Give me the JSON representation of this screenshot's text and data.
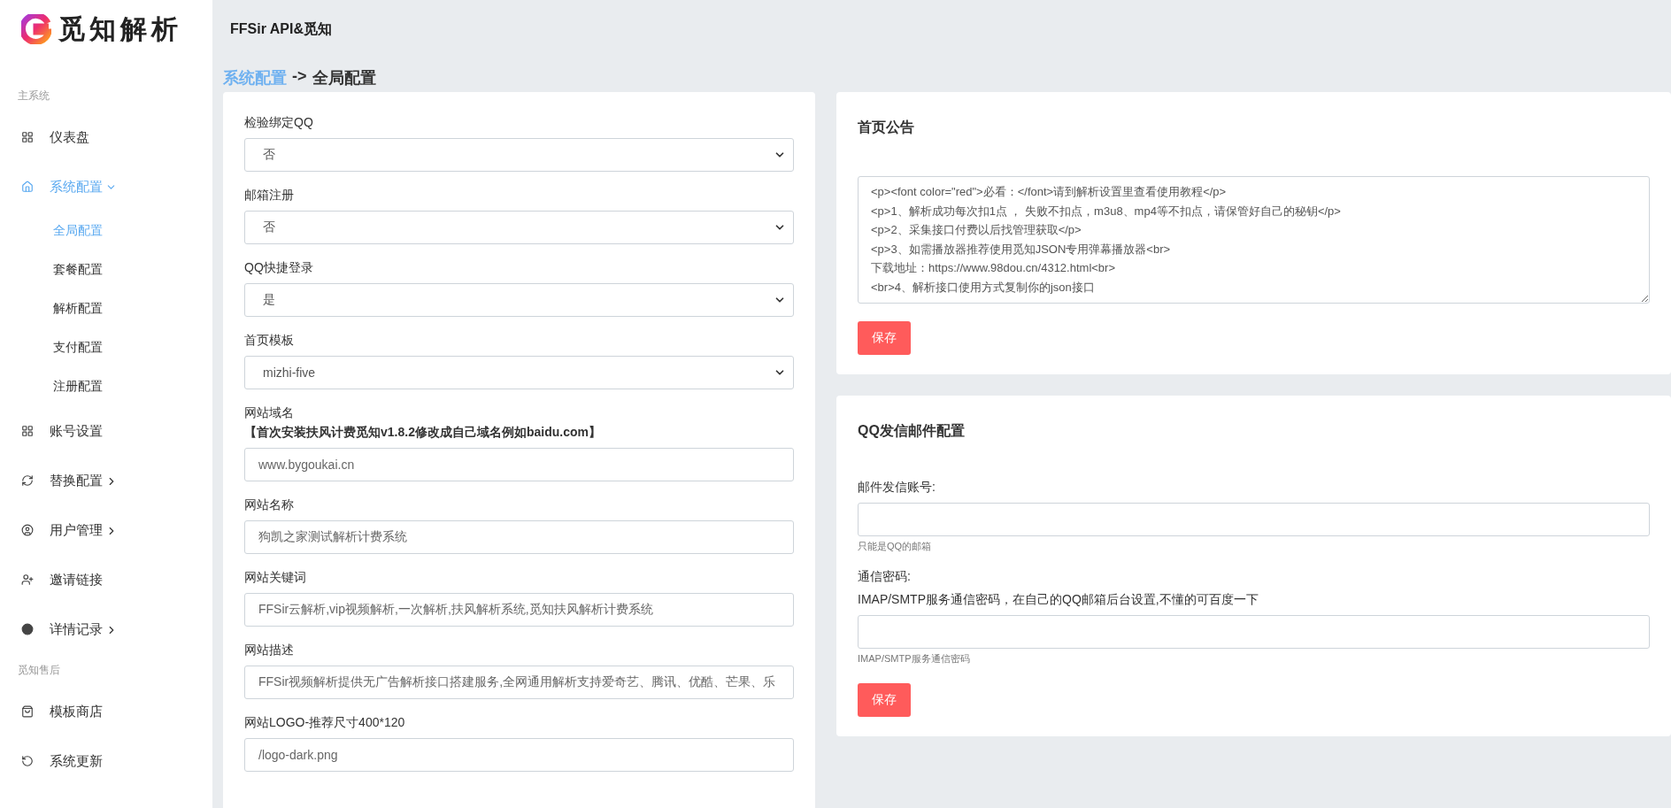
{
  "logo": {
    "text": "觅知解析"
  },
  "header": {
    "title": "FFSir API&觅知"
  },
  "sidebar": {
    "sections": [
      {
        "title": "主系统",
        "items": [
          {
            "label": "仪表盘",
            "has_submenu": false,
            "selected": false
          },
          {
            "label": "系统配置",
            "has_submenu": true,
            "expanded": true,
            "selected": true,
            "children": [
              {
                "label": "全局配置",
                "selected": true
              },
              {
                "label": "套餐配置",
                "selected": false
              },
              {
                "label": "解析配置",
                "selected": false
              },
              {
                "label": "支付配置",
                "selected": false
              },
              {
                "label": "注册配置",
                "selected": false
              }
            ]
          },
          {
            "label": "账号设置",
            "has_submenu": false,
            "selected": false
          },
          {
            "label": "替换配置",
            "has_submenu": true,
            "expanded": false,
            "selected": false
          },
          {
            "label": "用户管理",
            "has_submenu": true,
            "expanded": false,
            "selected": false
          },
          {
            "label": "邀请链接",
            "has_submenu": false,
            "selected": false
          },
          {
            "label": "详情记录",
            "has_submenu": true,
            "expanded": false,
            "selected": false
          }
        ]
      },
      {
        "title": "觅知售后",
        "items": [
          {
            "label": "模板商店",
            "has_submenu": false,
            "selected": false
          },
          {
            "label": "系统更新",
            "has_submenu": false,
            "selected": false
          }
        ]
      }
    ]
  },
  "breadcrumb": {
    "parent": "系统配置",
    "separator": "->",
    "current": "全局配置"
  },
  "global_form": {
    "fields": [
      {
        "kind": "select",
        "label": "检验绑定QQ",
        "value": "否"
      },
      {
        "kind": "select",
        "label": "邮箱注册",
        "value": "否"
      },
      {
        "kind": "select",
        "label": "QQ快捷登录",
        "value": "是"
      },
      {
        "kind": "select",
        "label": "首页模板",
        "value": "mizhi-five"
      },
      {
        "kind": "input",
        "label": "网站域名",
        "note": "【首次安装扶风计费觅知v1.8.2修改成自己域名例如baidu.com】",
        "value": "www.bygoukai.cn"
      },
      {
        "kind": "input",
        "label": "网站名称",
        "value": "狗凯之家测试解析计费系统"
      },
      {
        "kind": "input",
        "label": "网站关键词",
        "value": "FFSir云解析,vip视频解析,一次解析,扶风解析系统,觅知扶风解析计费系统"
      },
      {
        "kind": "input",
        "label": "网站描述",
        "value": "FFSir视频解析提供无广告解析接口搭建服务,全网通用解析支持爱奇艺、腾讯、优酷、芒果、乐"
      },
      {
        "kind": "input",
        "label": "网站LOGO-推荐尺寸400*120",
        "value": "/logo-dark.png"
      }
    ]
  },
  "notice_card": {
    "title": "首页公告",
    "lines": [
      "<p><font color=\"red\">必看：</font>请到解析设置里查看使用教程</p>",
      "<p>1、解析成功每次扣1点 ， 失败不扣点，m3u8、mp4等不扣点，请保管好自己的秘钥</p>",
      "<p>2、采集接口付费以后找管理获取</p>",
      "<p>3、如需播放器推荐使用觅知JSON专用弹幕播放器<br>",
      "下载地址：https://www.98dou.cn/4312.html<br>",
      "<br>4、解析接口使用方式复制你的json接口"
    ],
    "save_button": "保存"
  },
  "mail_card": {
    "title": "QQ发信邮件配置",
    "fields": [
      {
        "label": "邮件发信账号:",
        "help": "只能是QQ的邮箱"
      },
      {
        "label": "通信密码:",
        "note": "IMAP/SMTP服务通信密码，在自己的QQ邮箱后台设置,不懂的可百度一下",
        "help": "IMAP/SMTP服务通信密码"
      }
    ],
    "save_button": "保存"
  }
}
